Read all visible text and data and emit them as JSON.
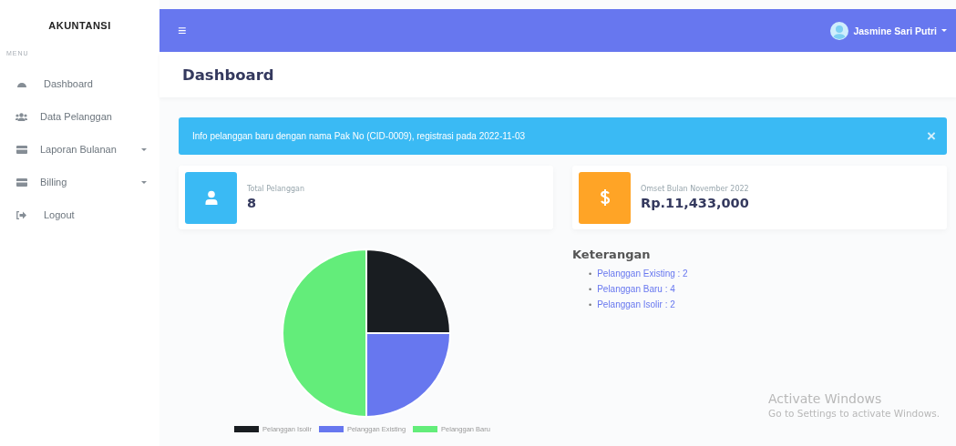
{
  "sidebar": {
    "brand": "AKUNTANSI",
    "section_label": "MENU",
    "items": [
      {
        "label": "Dashboard",
        "kind": "gauge",
        "has_submenu": false
      },
      {
        "label": "Data Pelanggan",
        "kind": "users",
        "has_submenu": false
      },
      {
        "label": "Laporan Bulanan",
        "kind": "card",
        "has_submenu": true
      },
      {
        "label": "Billing",
        "kind": "card",
        "has_submenu": true
      },
      {
        "label": "Logout",
        "kind": "logout",
        "has_submenu": false
      }
    ]
  },
  "topbar": {
    "menu_toggle": "≡",
    "user_name": "Jasmine Sari Putri"
  },
  "page_title": "Dashboard",
  "alert": {
    "text": "Info pelanggan baru dengan nama Pak No (CID-0009), registrasi pada 2022-11-03",
    "close": "×"
  },
  "stat_cards": [
    {
      "kind": "user",
      "label": "Total Pelanggan",
      "value": "8",
      "color": "#3abaf4"
    },
    {
      "kind": "dollar",
      "label": "Omset Bulan November 2022",
      "value": "Rp.11,433,000",
      "color": "#ffa426"
    }
  ],
  "chart_data": {
    "type": "pie",
    "categories": [
      "Pelanggan Isolir",
      "Pelanggan Existing",
      "Pelanggan Baru"
    ],
    "values": [
      25,
      25,
      50
    ],
    "colors": [
      "#191d21",
      "#6777ef",
      "#63ed7a"
    ],
    "legend": true
  },
  "keterangan": {
    "title": "Keterangan",
    "bullet": "•",
    "items": [
      "Pelanggan Existing : 2",
      "Pelanggan Baru : 4",
      "Pelanggan Isolir : 2"
    ]
  },
  "windows_notice": {
    "title": "Activate Windows",
    "subtitle": "Go to Settings to activate Windows."
  }
}
